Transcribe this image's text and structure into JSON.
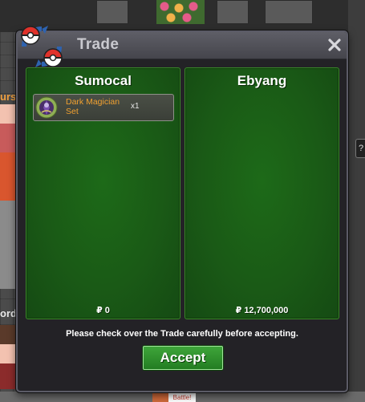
{
  "window": {
    "title": "Trade",
    "close_icon": "close-icon"
  },
  "background": {
    "left_name_fragment": "urse",
    "left_name_fragment_2": "ord",
    "bottom_tag": "Battle!",
    "help_tab": "?"
  },
  "trade": {
    "left": {
      "name": "Sumocal",
      "items": [
        {
          "name": "Dark Magician Set",
          "quantity": "x1",
          "icon": "magician-set-icon"
        }
      ],
      "money": "₽ 0"
    },
    "right": {
      "name": "Ebyang",
      "items": [],
      "money": "₽ 12,700,000"
    }
  },
  "notice": "Please check over the Trade carefully before accepting.",
  "accept_label": "Accept",
  "colors": {
    "panel_green": "#1a5a16",
    "accept_green": "#2f912d",
    "item_name": "#f0a030",
    "dialog_bg": "#232226",
    "title_bar": "#515158"
  }
}
